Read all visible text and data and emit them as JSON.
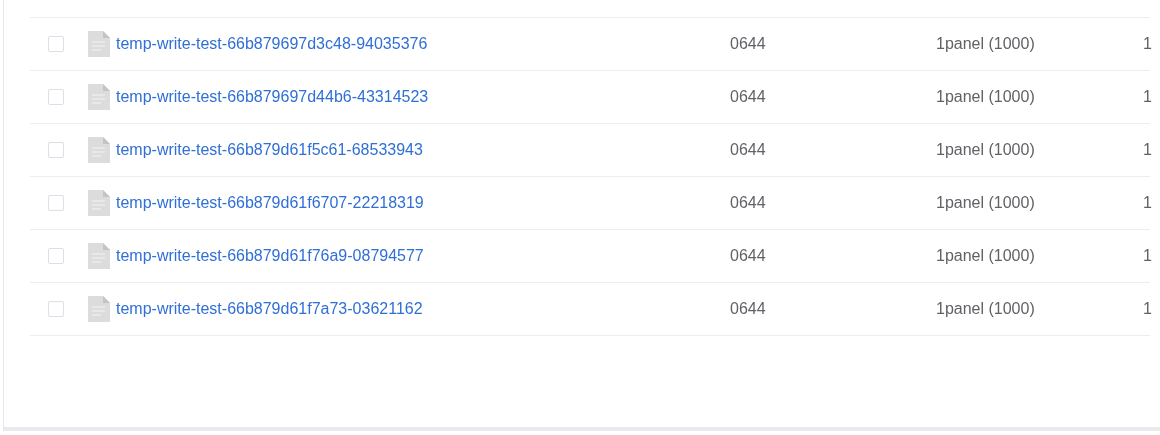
{
  "file_table": {
    "rows": [
      {
        "name": "temp-write-test-66b879697d3c48-94035376",
        "permission": "0644",
        "owner": "1panel (1000)",
        "column_4": "1",
        "checked": false
      },
      {
        "name": "temp-write-test-66b879697d44b6-43314523",
        "permission": "0644",
        "owner": "1panel (1000)",
        "column_4": "1",
        "checked": false
      },
      {
        "name": "temp-write-test-66b879d61f5c61-68533943",
        "permission": "0644",
        "owner": "1panel (1000)",
        "column_4": "1",
        "checked": false
      },
      {
        "name": "temp-write-test-66b879d61f6707-22218319",
        "permission": "0644",
        "owner": "1panel (1000)",
        "column_4": "1",
        "checked": false
      },
      {
        "name": "temp-write-test-66b879d61f76a9-08794577",
        "permission": "0644",
        "owner": "1panel (1000)",
        "column_4": "1",
        "checked": false
      },
      {
        "name": "temp-write-test-66b879d61f7a73-03621162",
        "permission": "0644",
        "owner": "1panel (1000)",
        "column_4": "1",
        "checked": false
      }
    ]
  }
}
